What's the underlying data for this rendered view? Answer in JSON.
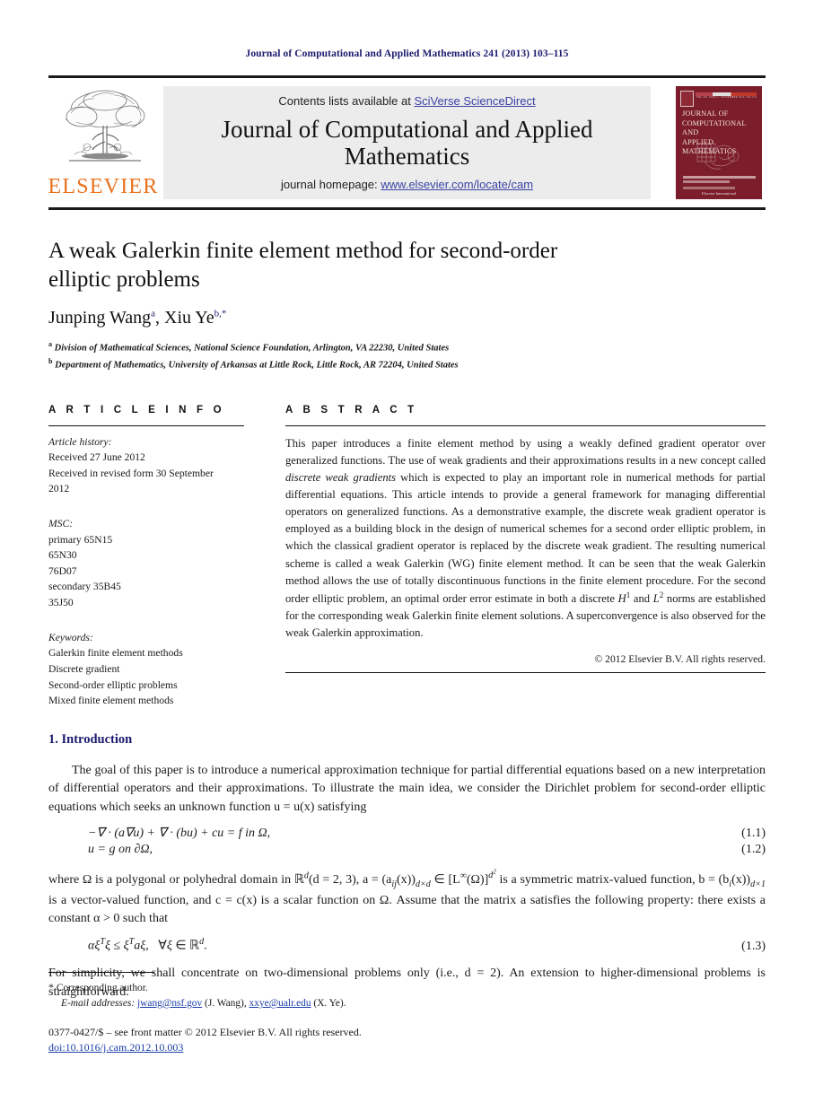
{
  "running_head": "Journal of Computational and Applied Mathematics 241 (2013) 103–115",
  "masthead": {
    "publisher_name": "ELSEVIER",
    "contents_prefix": "Contents lists available at ",
    "contents_link": "SciVerse ScienceDirect",
    "journal_title": "Journal of Computational and Applied Mathematics",
    "homepage_prefix": "journal homepage: ",
    "homepage_link": "www.elsevier.com/locate/cam",
    "cover": {
      "title_line1": "JOURNAL OF",
      "title_line2": "COMPUTATIONAL AND",
      "title_line3": "APPLIED MATHEMATICS",
      "brand": "Elsevier International"
    }
  },
  "article": {
    "title": "A weak Galerkin finite element method for second-order elliptic problems",
    "authors_html": "Junping Wang",
    "author1": "Junping Wang",
    "author1_mark": "a",
    "author2": "Xiu Ye",
    "author2_mark": "b,*",
    "separator": ", ",
    "affiliations": [
      {
        "mark": "a",
        "text": "Division of Mathematical Sciences, National Science Foundation, Arlington, VA 22230, United States"
      },
      {
        "mark": "b",
        "text": "Department of Mathematics, University of Arkansas at Little Rock, Little Rock, AR 72204, United States"
      }
    ]
  },
  "info": {
    "heading": "A R T I C L E    I N F O",
    "history_label": "Article history:",
    "history_lines": [
      "Received 27 June 2012",
      "Received in revised form 30 September",
      "2012"
    ],
    "msc_label": "MSC:",
    "msc_lines": [
      "primary 65N15",
      "65N30",
      "76D07",
      "secondary 35B45",
      "35J50"
    ],
    "keywords_label": "Keywords:",
    "keywords": [
      "Galerkin finite element methods",
      "Discrete gradient",
      "Second-order elliptic problems",
      "Mixed finite element methods"
    ]
  },
  "abstract": {
    "heading": "A B S T R A C T",
    "part1": "This paper introduces a finite element method by using a weakly defined gradient operator over generalized functions. The use of weak gradients and their approximations results in a new concept called ",
    "italic1": "discrete weak gradients",
    "part2": " which is expected to play an important role in numerical methods for partial differential equations. This article intends to provide a general framework for managing differential operators on generalized functions. As a demonstrative example, the discrete weak gradient operator is employed as a building block in the design of numerical schemes for a second order elliptic problem, in which the classical gradient operator is replaced by the discrete weak gradient. The resulting numerical scheme is called a weak Galerkin (WG) finite element method. It can be seen that the weak Galerkin method allows the use of totally discontinuous functions in the finite element procedure. For the second order elliptic problem, an optimal order error estimate in both a discrete ",
    "h1": "H",
    "h1sup": "1",
    "part3": " and ",
    "l2": "L",
    "l2sup": "2",
    "part4": " norms are established for the corresponding weak Galerkin finite element solutions. A superconvergence is also observed for the weak Galerkin approximation.",
    "copyright": "© 2012 Elsevier B.V. All rights reserved."
  },
  "introduction": {
    "heading": "1. Introduction",
    "para1": "The goal of this paper is to introduce a numerical approximation technique for partial differential equations based on a new interpretation of differential operators and their approximations. To illustrate the main idea, we consider the Dirichlet problem for second-order elliptic equations which seeks an unknown function u = u(x) satisfying",
    "equations": [
      {
        "body": "−∇ · (a∇u) + ∇ · (bu) + cu = f    in Ω,",
        "number": "(1.1)"
      },
      {
        "body": "u = g    on ∂Ω,",
        "number": "(1.2)"
      }
    ],
    "para2_a": "where Ω is a polygonal or polyhedral domain in ℝ",
    "para2_b": "(d = 2, 3), a = (a",
    "para2_c": "(x))",
    "para2_d": " ∈ [L",
    "para2_e": "(Ω)]",
    "para2_f": " is a symmetric matrix-valued function, b = (b",
    "para2_g": "(x))",
    "para2_h": " is a vector-valued function, and c = c(x) is a scalar function on Ω. Assume that the matrix a satisfies the following property: there exists a constant α > 0 such that",
    "equation3": {
      "body": "αξ",
      "number": "(1.3)"
    },
    "equation3_full": "αξᵀξ ≤ ξᵀaξ,   ∀ξ ∈ ℝᵈ.",
    "para3": "For simplicity, we shall concentrate on two-dimensional problems only (i.e., d = 2). An extension to higher-dimensional problems is straightforward."
  },
  "footnotes": {
    "corresponding": "Corresponding author.",
    "star": "*",
    "email_label": "E-mail addresses:",
    "email1": "jwang@nsf.gov",
    "email1_who": " (J. Wang), ",
    "email2": "xxye@ualr.edu",
    "email2_who": " (X. Ye).",
    "issn_line": "0377-0427/$ – see front matter © 2012 Elsevier B.V. All rights reserved.",
    "doi_line": "doi:10.1016/j.cam.2012.10.003"
  },
  "colors": {
    "link_blue": "#3a43a4",
    "heading_navy": "#1a1a6e",
    "elsevier_orange": "#E9711C",
    "cover_maroon": "#7c1d2b",
    "banner_grey": "#ececec"
  }
}
